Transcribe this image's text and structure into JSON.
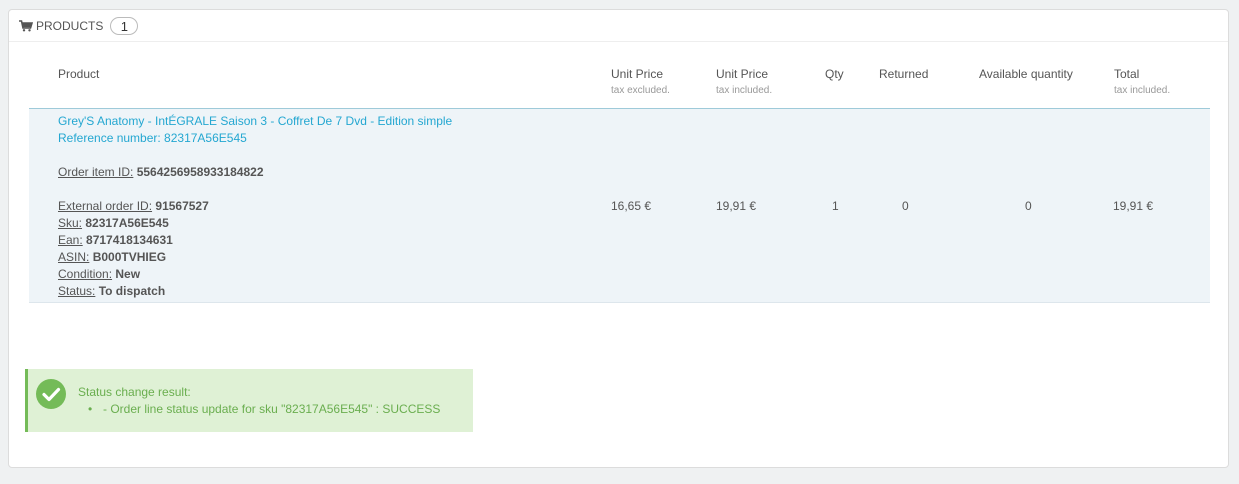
{
  "panel": {
    "title": "PRODUCTS",
    "count": "1"
  },
  "table": {
    "headers": {
      "product": "Product",
      "unit_price_ex": "Unit Price",
      "unit_price_ex_sub": "tax excluded.",
      "unit_price_inc": "Unit Price",
      "unit_price_inc_sub": "tax included.",
      "qty": "Qty",
      "returned": "Returned",
      "available": "Available quantity",
      "total": "Total",
      "total_sub": "tax included."
    },
    "row": {
      "name": "Grey'S Anatomy - IntÉGRALE Saison 3 - Coffret De 7 Dvd - Edition simple",
      "reference": "Reference number: 82317A56E545",
      "order_item_label": "Order item ID:",
      "order_item_value": "5564256958933184822",
      "external_order_label": "External order ID:",
      "external_order_value": "91567527",
      "sku_label": "Sku:",
      "sku_value": "82317A56E545",
      "ean_label": "Ean:",
      "ean_value": "8717418134631",
      "asin_label": "ASIN:",
      "asin_value": "B000TVHIEG",
      "condition_label": "Condition:",
      "condition_value": "New",
      "status_label": "Status:",
      "status_value": "To dispatch",
      "unit_price_ex": "16,65 €",
      "unit_price_inc": "19,91 €",
      "qty": "1",
      "returned": "0",
      "available": "0",
      "total": "19,91 €"
    }
  },
  "alert": {
    "title": "Status change result:",
    "items": [
      "- Order line status update for sku \"82317A56E545\" : SUCCESS"
    ]
  },
  "icons": {
    "cart": "shopping-cart-icon",
    "check": "check-circle-icon"
  },
  "colors": {
    "link": "#24a7d1",
    "success_text": "#6aae4f",
    "success_bg": "#dff1d5",
    "success_border": "#74bb58",
    "row_bg": "#eef4f8"
  }
}
